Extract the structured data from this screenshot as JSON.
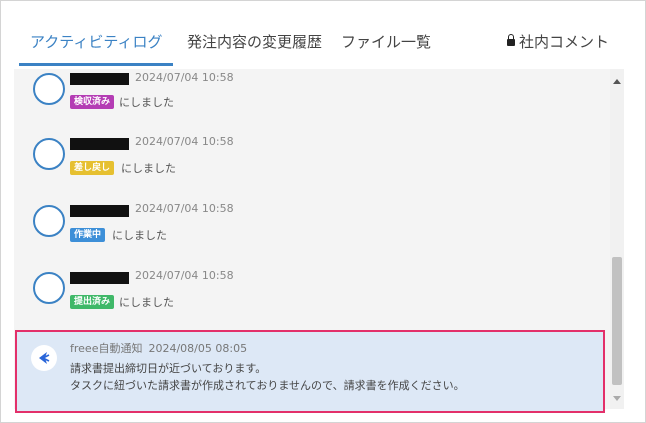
{
  "tabs": [
    {
      "label": "アクティビティログ",
      "active": true
    },
    {
      "label": "発注内容の変更履歴",
      "active": false
    },
    {
      "label": "ファイル一覧",
      "active": false
    },
    {
      "label": "社内コメント",
      "active": false,
      "icon": "lock-icon"
    }
  ],
  "activity": [
    {
      "timestamp": "2024/07/04 10:58",
      "badge": "検収済み",
      "badge_color": "#b43cb4",
      "text": "にしました"
    },
    {
      "timestamp": "2024/07/04 10:58",
      "badge": "差し戻し",
      "badge_color": "#e6c030",
      "text": "にしました"
    },
    {
      "timestamp": "2024/07/04 10:58",
      "badge": "作業中",
      "badge_color": "#3d8fd8",
      "text": "にしました"
    },
    {
      "timestamp": "2024/07/04 10:58",
      "badge": "提出済み",
      "badge_color": "#3fb868",
      "text": "にしました"
    }
  ],
  "notice": {
    "sender": "freee自動通知",
    "timestamp": "2024/08/05 08:05",
    "line1": "請求書提出締切日が近づいております。",
    "line2": "タスクに紐づいた請求書が作成されておりませんので、請求書を作成ください。",
    "highlight_color": "#e3306a",
    "icon": "freee-logo-icon"
  }
}
